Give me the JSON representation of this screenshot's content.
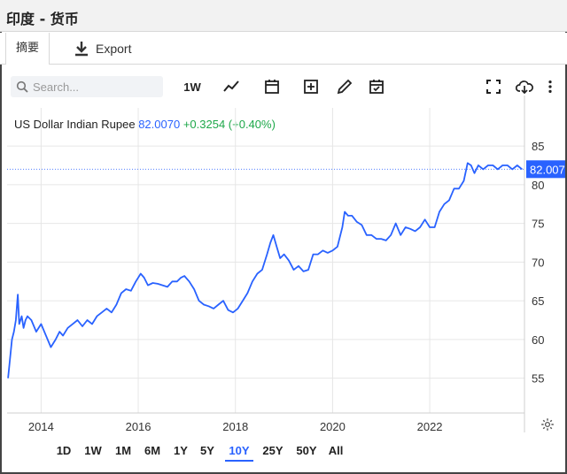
{
  "window": {
    "title": "印度 - 货币"
  },
  "tabs": {
    "summary_label": "摘要",
    "export_label": "Export"
  },
  "toolbar": {
    "search_placeholder": "Search...",
    "interval_label": "1W",
    "icons": [
      "line-chart-icon",
      "calendar-icon",
      "add-indicator-icon",
      "draw-pencil-icon",
      "event-calendar-icon",
      "fullscreen-icon",
      "download-cloud-icon",
      "more-vertical-icon"
    ]
  },
  "instrument": {
    "name": "US Dollar Indian Rupee",
    "price": "82.0070",
    "change": "+0.3254 (+0.40%)",
    "last_label": "82.007"
  },
  "ranges": [
    "1D",
    "1W",
    "1M",
    "6M",
    "1Y",
    "5Y",
    "10Y",
    "25Y",
    "50Y",
    "All"
  ],
  "active_range": "10Y",
  "colors": {
    "line": "#2962ff",
    "positive": "#1ea84a",
    "grid": "#e6e6e6"
  },
  "chart_data": {
    "type": "line",
    "title": "",
    "xlabel": "",
    "ylabel": "",
    "xlim": [
      2013.3,
      2023.95
    ],
    "ylim": [
      50.5,
      86.5
    ],
    "x_ticks": [
      2014,
      2016,
      2018,
      2020,
      2022
    ],
    "x_tick_labels": [
      "2014",
      "2016",
      "2018",
      "2020",
      "2022"
    ],
    "y_ticks": [
      55,
      60,
      65,
      70,
      75,
      80,
      85
    ],
    "y_tick_labels": [
      "55",
      "60",
      "65",
      "70",
      "75",
      "80",
      "85"
    ],
    "grid": true,
    "last_value": 82.007,
    "series": [
      {
        "name": "",
        "x": [
          2013.32,
          2013.36,
          2013.4,
          2013.44,
          2013.48,
          2013.52,
          2013.55,
          2013.6,
          2013.64,
          2013.68,
          2013.72,
          2013.8,
          2013.9,
          2014.0,
          2014.1,
          2014.2,
          2014.3,
          2014.38,
          2014.45,
          2014.55,
          2014.65,
          2014.75,
          2014.85,
          2014.95,
          2015.05,
          2015.15,
          2015.25,
          2015.35,
          2015.45,
          2015.55,
          2015.65,
          2015.75,
          2015.85,
          2015.95,
          2016.05,
          2016.12,
          2016.2,
          2016.3,
          2016.4,
          2016.5,
          2016.6,
          2016.7,
          2016.8,
          2016.88,
          2016.95,
          2017.05,
          2017.15,
          2017.25,
          2017.35,
          2017.45,
          2017.55,
          2017.65,
          2017.75,
          2017.85,
          2017.95,
          2018.05,
          2018.15,
          2018.25,
          2018.35,
          2018.45,
          2018.55,
          2018.65,
          2018.72,
          2018.78,
          2018.85,
          2018.92,
          2019.0,
          2019.1,
          2019.2,
          2019.3,
          2019.4,
          2019.5,
          2019.6,
          2019.7,
          2019.8,
          2019.9,
          2020.0,
          2020.1,
          2020.2,
          2020.25,
          2020.32,
          2020.4,
          2020.5,
          2020.6,
          2020.7,
          2020.8,
          2020.9,
          2021.0,
          2021.1,
          2021.2,
          2021.3,
          2021.4,
          2021.5,
          2021.6,
          2021.7,
          2021.8,
          2021.9,
          2022.0,
          2022.1,
          2022.2,
          2022.3,
          2022.4,
          2022.5,
          2022.6,
          2022.7,
          2022.78,
          2022.85,
          2022.92,
          2023.0,
          2023.1,
          2023.2,
          2023.3,
          2023.4,
          2023.5,
          2023.6,
          2023.7,
          2023.8,
          2023.9
        ],
        "y": [
          55.0,
          57.5,
          60.0,
          61.0,
          62.5,
          65.8,
          62.0,
          63.0,
          61.5,
          62.5,
          63.0,
          62.5,
          61.0,
          62.0,
          60.5,
          59.0,
          60.0,
          61.0,
          60.5,
          61.5,
          62.0,
          62.5,
          61.7,
          62.5,
          62.0,
          63.0,
          63.5,
          64.0,
          63.5,
          64.5,
          66.0,
          66.5,
          66.3,
          67.5,
          68.5,
          68.0,
          67.0,
          67.3,
          67.2,
          67.0,
          66.8,
          67.5,
          67.5,
          68.0,
          68.2,
          67.5,
          66.5,
          65.0,
          64.5,
          64.3,
          64.0,
          64.5,
          65.0,
          63.8,
          63.5,
          64.0,
          65.0,
          66.0,
          67.5,
          68.5,
          69.0,
          71.0,
          72.5,
          73.5,
          72.0,
          70.5,
          71.0,
          70.2,
          69.0,
          69.5,
          68.8,
          69.0,
          71.0,
          71.0,
          71.5,
          71.2,
          71.5,
          72.0,
          74.5,
          76.5,
          76.0,
          76.0,
          75.2,
          74.8,
          73.5,
          73.5,
          73.0,
          73.0,
          72.8,
          73.5,
          75.0,
          73.5,
          74.5,
          74.3,
          74.0,
          74.5,
          75.5,
          74.5,
          74.5,
          76.5,
          77.5,
          78.0,
          79.5,
          79.5,
          80.5,
          82.8,
          82.5,
          81.5,
          82.5,
          82.0,
          82.5,
          82.5,
          82.0,
          82.5,
          82.5,
          82.0,
          82.5,
          82.0
        ]
      }
    ]
  }
}
